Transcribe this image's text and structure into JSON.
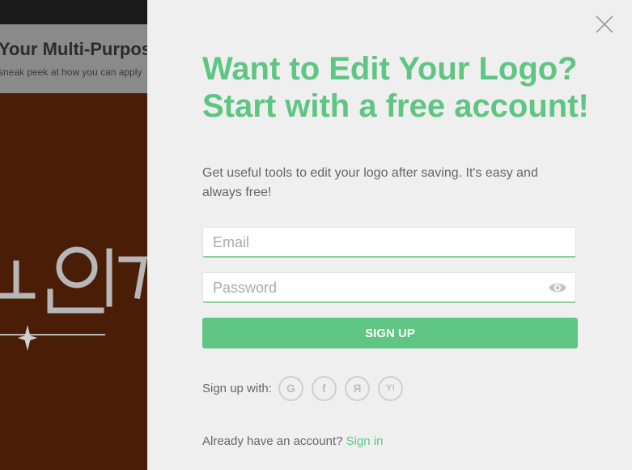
{
  "background": {
    "title": "Your Multi-Purpose",
    "subtitle": "sneak peek at how you can apply"
  },
  "modal": {
    "headline": "Want to Edit Your Logo? Start with a free account!",
    "description": "Get useful tools to edit your logo after saving. It's easy and always free!",
    "email_placeholder": "Email",
    "password_placeholder": "Password",
    "signup_label": "SIGN UP",
    "social_label": "Sign up with:",
    "social_buttons": [
      "G",
      "f",
      "Я",
      "Y!"
    ],
    "signin_prompt": "Already have an account?",
    "signin_link": "Sign in",
    "accent_color": "#5fc582"
  }
}
